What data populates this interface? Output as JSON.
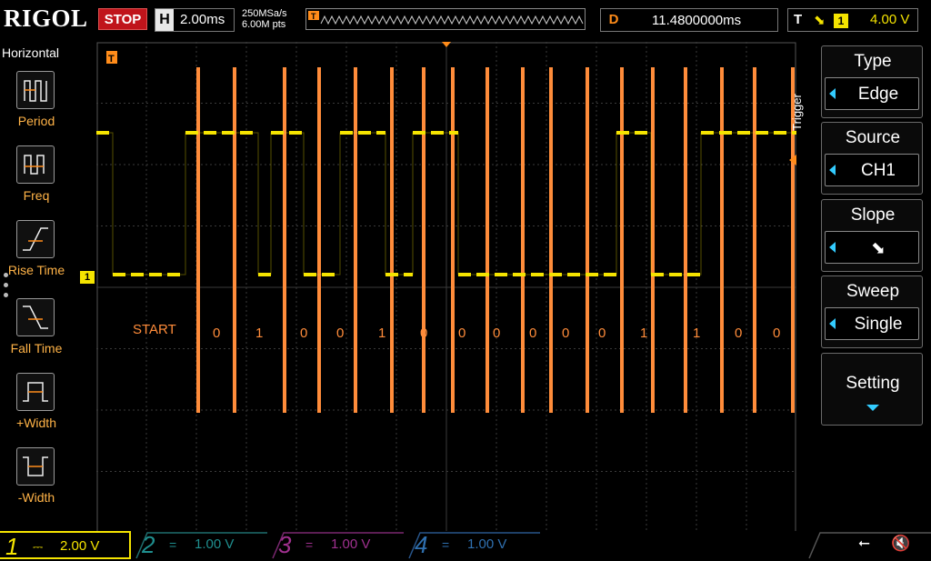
{
  "header": {
    "brand": "RIGOL",
    "run_state": "STOP",
    "horizontal": {
      "label": "H",
      "value": "2.00ms"
    },
    "sample_rate": "250MSa/s",
    "memory_depth": "6.00M pts",
    "delay": {
      "label": "D",
      "value": "11.4800000ms"
    },
    "trigger": {
      "label": "T",
      "edge_symbol": "⬊",
      "channel": "1",
      "level": "4.00 V"
    }
  },
  "left_menu": {
    "title": "Horizontal",
    "items": [
      {
        "label": "Period"
      },
      {
        "label": "Freq"
      },
      {
        "label": "Rise Time"
      },
      {
        "label": "Fall Time"
      },
      {
        "label": "+Width"
      },
      {
        "label": "-Width"
      }
    ]
  },
  "right_menu": {
    "side_label": "Trigger",
    "items": [
      {
        "title": "Type",
        "value": "Edge"
      },
      {
        "title": "Source",
        "value": "CH1"
      },
      {
        "title": "Slope",
        "value": "⬊"
      },
      {
        "title": "Sweep",
        "value": "Single"
      }
    ],
    "setting_label": "Setting"
  },
  "markers": {
    "trigger_marker": "T",
    "channel_marker": "1"
  },
  "annotations": {
    "start_label": "START",
    "bits": [
      "0",
      "1",
      "0",
      "0",
      "1",
      "0",
      "0",
      "0",
      "0",
      "0",
      "0",
      "1",
      "1",
      "0",
      "0"
    ]
  },
  "channels": [
    {
      "num": "1",
      "coupling": "⎓",
      "scale": "2.00 V",
      "color": "#f5e400",
      "active": true
    },
    {
      "num": "2",
      "coupling": "=",
      "scale": "1.00 V",
      "color": "#1f8f8f",
      "active": false
    },
    {
      "num": "3",
      "coupling": "=",
      "scale": "1.00 V",
      "color": "#a0308f",
      "active": false
    },
    {
      "num": "4",
      "coupling": "=",
      "scale": "1.00 V",
      "color": "#2f70b0",
      "active": false
    }
  ],
  "status_icons": {
    "usb": "usb-icon",
    "mute": "mute-icon"
  },
  "colors": {
    "trace": "#f5e400",
    "annotation": "#ff8c3a",
    "grid": "#3a3a3a"
  }
}
